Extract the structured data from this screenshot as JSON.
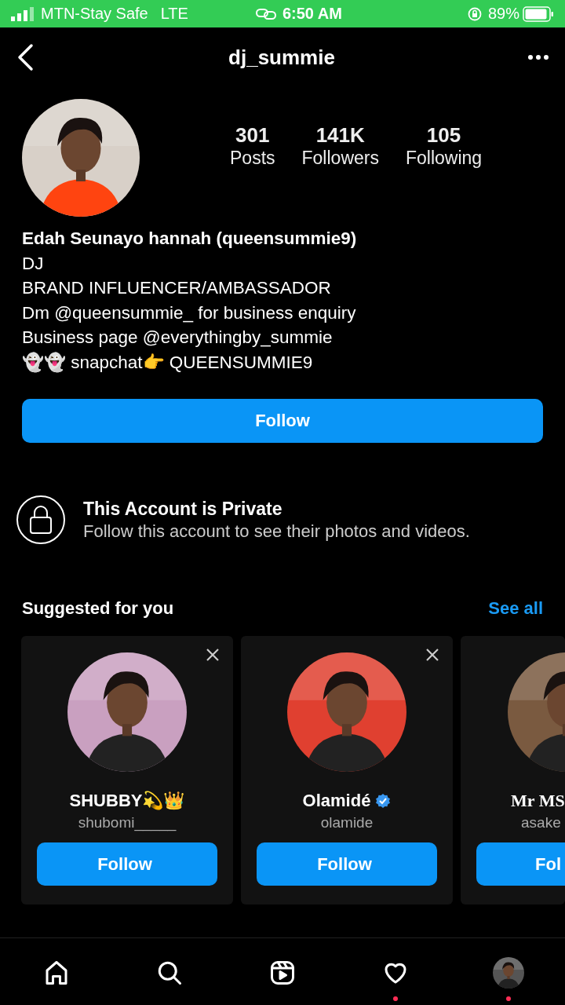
{
  "status_bar": {
    "carrier": "MTN-Stay Safe",
    "network": "LTE",
    "time": "6:50 AM",
    "battery": "89%"
  },
  "header": {
    "title": "dj_summie"
  },
  "profile": {
    "stats": [
      {
        "value": "301",
        "label": "Posts"
      },
      {
        "value": "141K",
        "label": "Followers"
      },
      {
        "value": "105",
        "label": "Following"
      }
    ],
    "name": "Edah Seunayo hannah (queensummie9)",
    "bio": [
      "DJ",
      "BRAND INFLUENCER/AMBASSADOR",
      "Dm @queensummie_  for business enquiry",
      "Business page @everythingby_summie",
      "👻👻 snapchat👉 QUEENSUMMIE9"
    ],
    "follow_button": "Follow"
  },
  "private_notice": {
    "title": "This Account is Private",
    "text": "Follow this account to see their photos and videos."
  },
  "suggested": {
    "title": "Suggested for you",
    "see_all": "See all",
    "items": [
      {
        "kind": "full",
        "name": "SHUBBY💫👑",
        "username": "shubomi_____",
        "verified": false,
        "button": "Follow"
      },
      {
        "kind": "full",
        "name": "Olamidé",
        "username": "olamide",
        "verified": true,
        "button": "Follow"
      },
      {
        "kind": "partial",
        "name": "Mr MS",
        "username": "asake",
        "verified": false,
        "button": "Fol"
      }
    ]
  },
  "nav": [
    {
      "kind": "home",
      "dot": false
    },
    {
      "kind": "search",
      "dot": false
    },
    {
      "kind": "reels",
      "dot": false
    },
    {
      "kind": "heart",
      "dot": true
    },
    {
      "kind": "profile",
      "dot": true
    }
  ]
}
